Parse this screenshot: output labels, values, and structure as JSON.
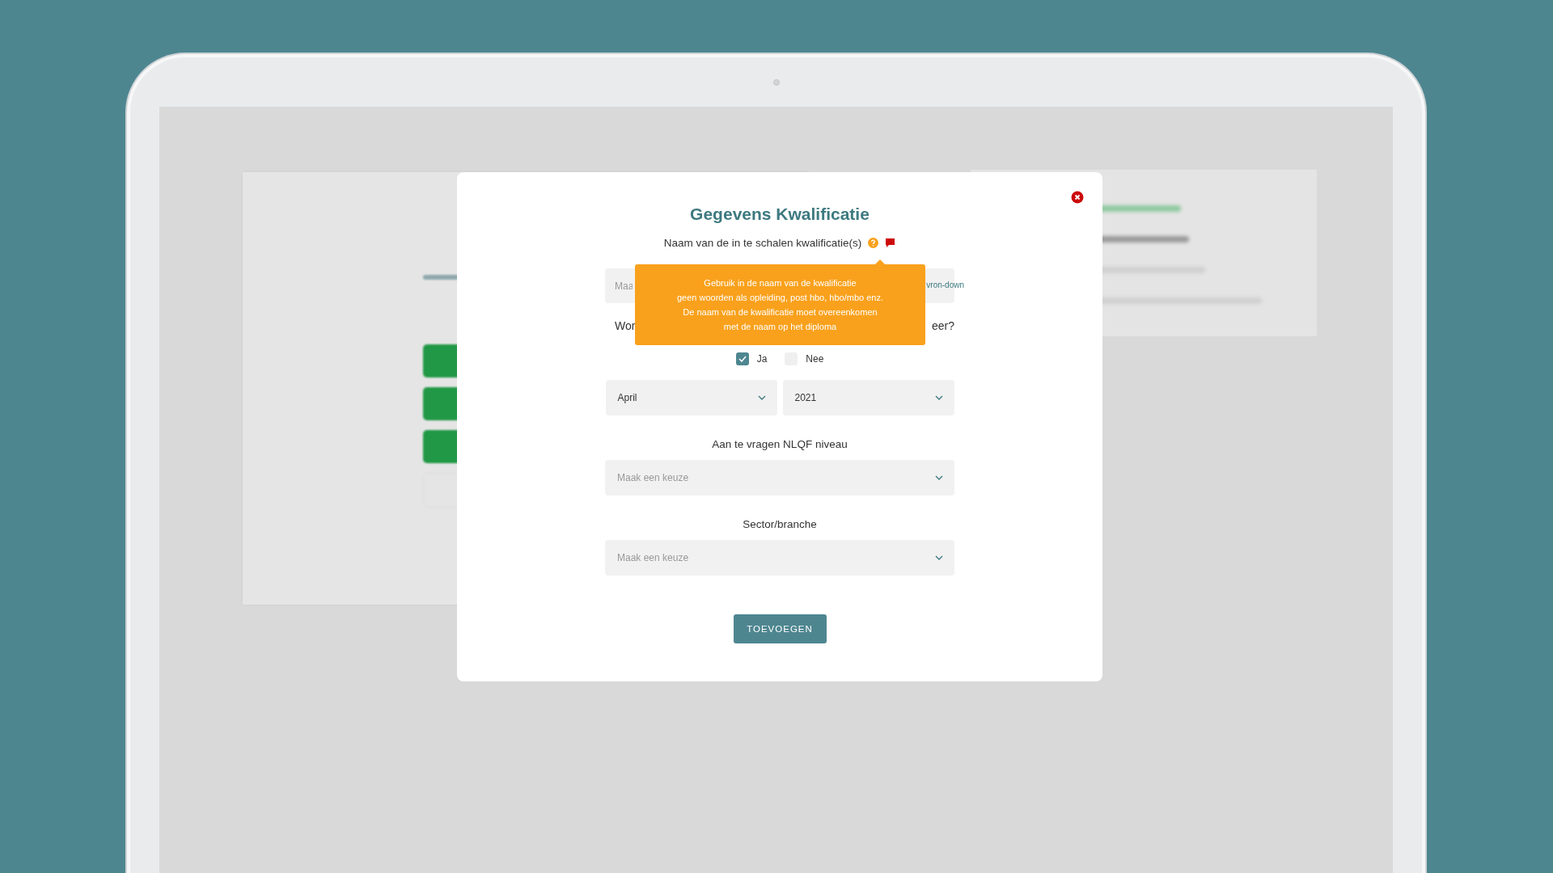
{
  "modal": {
    "title": "Gegevens Kwalificatie",
    "name_label": "Naam van de in te schalen kwalificatie(s)",
    "name_field": {
      "placeholder": "Maa",
      "icon_text": "vron-down"
    },
    "tooltip": {
      "lines": [
        "Gebruik in de naam van de kwalificatie",
        "geen woorden als opleiding, post hbo, hbo/mbo enz.",
        "De naam van de kwalificatie moet overeenkomen",
        "met de naam op het diploma"
      ]
    },
    "question": {
      "start": "Wor",
      "end": "eer?"
    },
    "options": [
      {
        "label": "Ja",
        "checked": true
      },
      {
        "label": "Nee",
        "checked": false
      }
    ],
    "date_selects": [
      {
        "value": "April"
      },
      {
        "value": "2021"
      }
    ],
    "nlqf": {
      "label": "Aan te vragen NLQF niveau",
      "placeholder": "Maak een keuze"
    },
    "sector": {
      "label": "Sector/branche",
      "placeholder": "Maak een keuze"
    },
    "submit_button": "TOEVOEGEN"
  }
}
